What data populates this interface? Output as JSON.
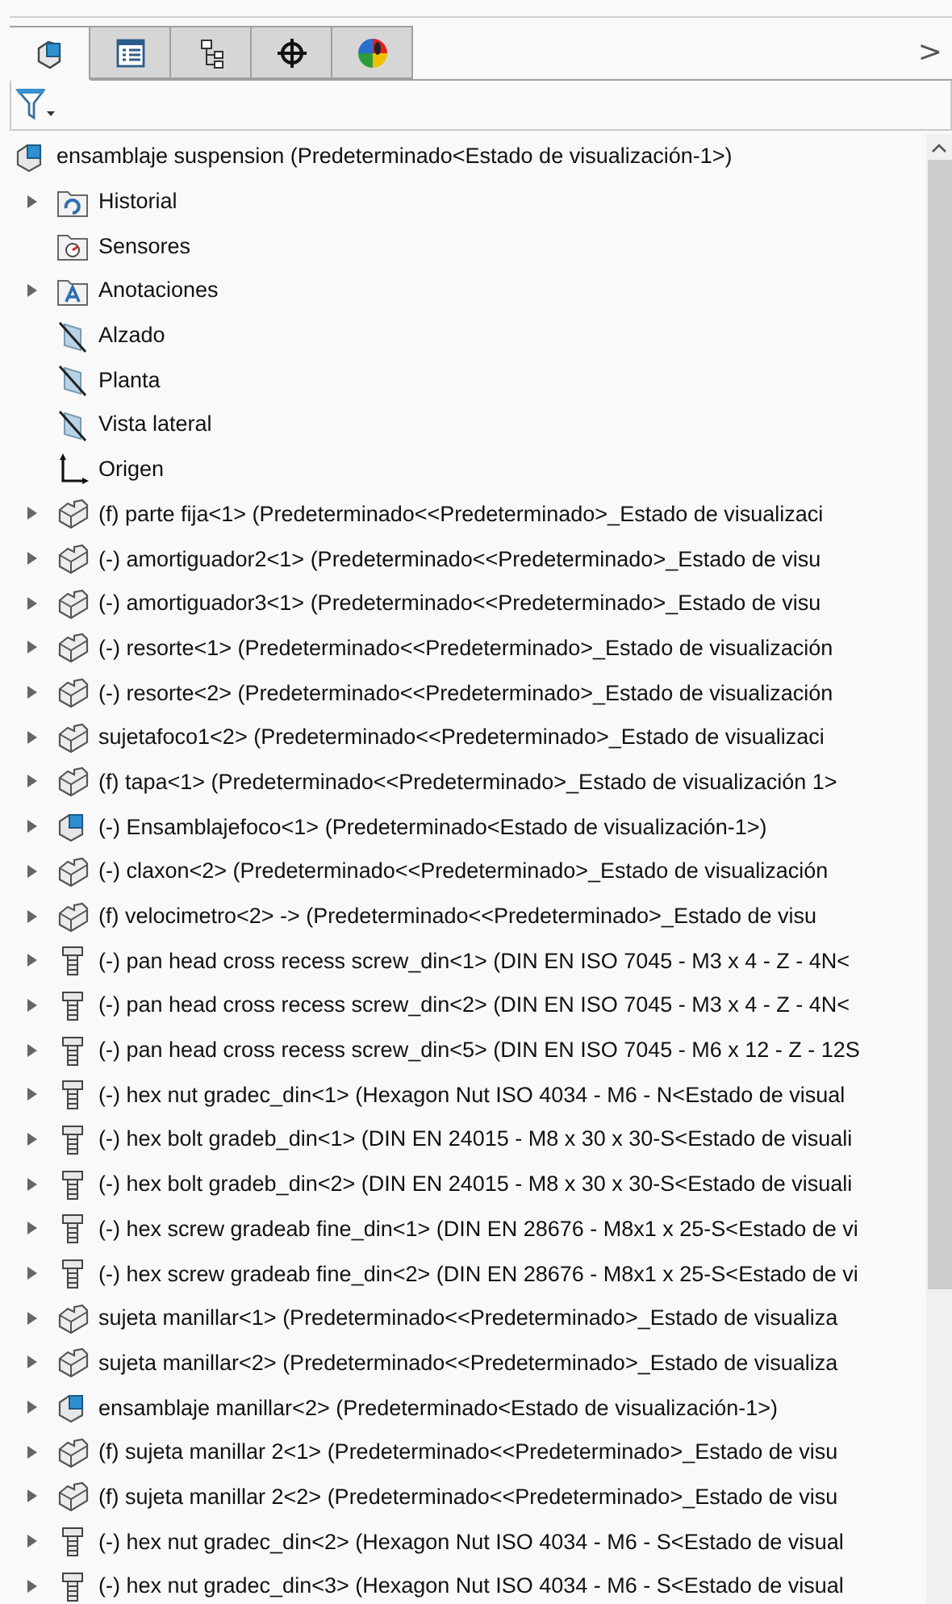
{
  "tabs": [
    {
      "kind": "feature-tree",
      "selected": true
    },
    {
      "kind": "property",
      "selected": false
    },
    {
      "kind": "configuration",
      "selected": false
    },
    {
      "kind": "dimxpert",
      "selected": false
    },
    {
      "kind": "display",
      "selected": false
    }
  ],
  "tabs_more": ">",
  "root": {
    "label": "ensamblaje suspension  (Predeterminado<Estado de visualización-1>)"
  },
  "tree": [
    {
      "kind": "history",
      "label": "Historial",
      "expandable": true
    },
    {
      "kind": "sensors",
      "label": "Sensores",
      "expandable": false
    },
    {
      "kind": "annotations",
      "label": "Anotaciones",
      "expandable": true
    },
    {
      "kind": "plane",
      "label": "Alzado",
      "expandable": false
    },
    {
      "kind": "plane",
      "label": "Planta",
      "expandable": false
    },
    {
      "kind": "plane",
      "label": "Vista lateral",
      "expandable": false
    },
    {
      "kind": "origin",
      "label": "Origen",
      "expandable": false
    },
    {
      "kind": "part",
      "label": "(f) parte fija<1> (Predeterminado<<Predeterminado>_Estado de visualizaci",
      "expandable": true
    },
    {
      "kind": "part",
      "label": "(-) amortiguador2<1> (Predeterminado<<Predeterminado>_Estado de visu",
      "expandable": true
    },
    {
      "kind": "part",
      "label": "(-) amortiguador3<1> (Predeterminado<<Predeterminado>_Estado de visu",
      "expandable": true
    },
    {
      "kind": "part",
      "label": "(-) resorte<1> (Predeterminado<<Predeterminado>_Estado de visualización",
      "expandable": true
    },
    {
      "kind": "part",
      "label": "(-) resorte<2> (Predeterminado<<Predeterminado>_Estado de visualización",
      "expandable": true
    },
    {
      "kind": "part",
      "label": "sujetafoco1<2> (Predeterminado<<Predeterminado>_Estado de visualizaci",
      "expandable": true
    },
    {
      "kind": "part",
      "label": "(f) tapa<1> (Predeterminado<<Predeterminado>_Estado de visualización 1>",
      "expandable": true
    },
    {
      "kind": "assembly",
      "label": "(-) Ensamblajefoco<1> (Predeterminado<Estado de visualización-1>)",
      "expandable": true
    },
    {
      "kind": "part",
      "label": "(-) claxon<2> (Predeterminado<<Predeterminado>_Estado de visualización",
      "expandable": true
    },
    {
      "kind": "part",
      "label": "(f) velocimetro<2> -> (Predeterminado<<Predeterminado>_Estado de visu",
      "expandable": true
    },
    {
      "kind": "fastener",
      "label": "(-) pan head cross recess screw_din<1> (DIN EN ISO 7045 - M3 x 4 - Z - 4N<",
      "expandable": true
    },
    {
      "kind": "fastener",
      "label": "(-) pan head cross recess screw_din<2> (DIN EN ISO 7045 - M3 x 4 - Z - 4N<",
      "expandable": true
    },
    {
      "kind": "fastener",
      "label": "(-) pan head cross recess screw_din<5> (DIN EN ISO 7045 - M6 x 12 - Z - 12S",
      "expandable": true
    },
    {
      "kind": "fastener",
      "label": "(-) hex nut gradec_din<1> (Hexagon Nut ISO 4034 - M6 - N<Estado de visual",
      "expandable": true
    },
    {
      "kind": "fastener",
      "label": "(-) hex bolt gradeb_din<1> (DIN EN 24015 - M8 x 30 x 30-S<Estado de visuali",
      "expandable": true
    },
    {
      "kind": "fastener",
      "label": "(-) hex bolt gradeb_din<2> (DIN EN 24015 - M8 x 30 x 30-S<Estado de visuali",
      "expandable": true
    },
    {
      "kind": "fastener",
      "label": "(-) hex screw gradeab fine_din<1> (DIN EN 28676 - M8x1 x 25-S<Estado de vi",
      "expandable": true
    },
    {
      "kind": "fastener",
      "label": "(-) hex screw gradeab fine_din<2> (DIN EN 28676 - M8x1 x 25-S<Estado de vi",
      "expandable": true
    },
    {
      "kind": "part",
      "label": "sujeta manillar<1> (Predeterminado<<Predeterminado>_Estado de visualiza",
      "expandable": true
    },
    {
      "kind": "part",
      "label": "sujeta manillar<2> (Predeterminado<<Predeterminado>_Estado de visualiza",
      "expandable": true
    },
    {
      "kind": "assembly",
      "label": "ensamblaje manillar<2> (Predeterminado<Estado de visualización-1>)",
      "expandable": true
    },
    {
      "kind": "part",
      "label": "(f) sujeta manillar 2<1> (Predeterminado<<Predeterminado>_Estado de visu",
      "expandable": true
    },
    {
      "kind": "part",
      "label": "(f) sujeta manillar 2<2> (Predeterminado<<Predeterminado>_Estado de visu",
      "expandable": true
    },
    {
      "kind": "fastener",
      "label": "(-) hex nut gradec_din<2> (Hexagon Nut ISO 4034 - M6 - S<Estado de visual",
      "expandable": true
    },
    {
      "kind": "fastener",
      "label": "(-) hex nut gradec_din<3> (Hexagon Nut ISO 4034 - M6 - S<Estado de visual",
      "expandable": true
    }
  ]
}
